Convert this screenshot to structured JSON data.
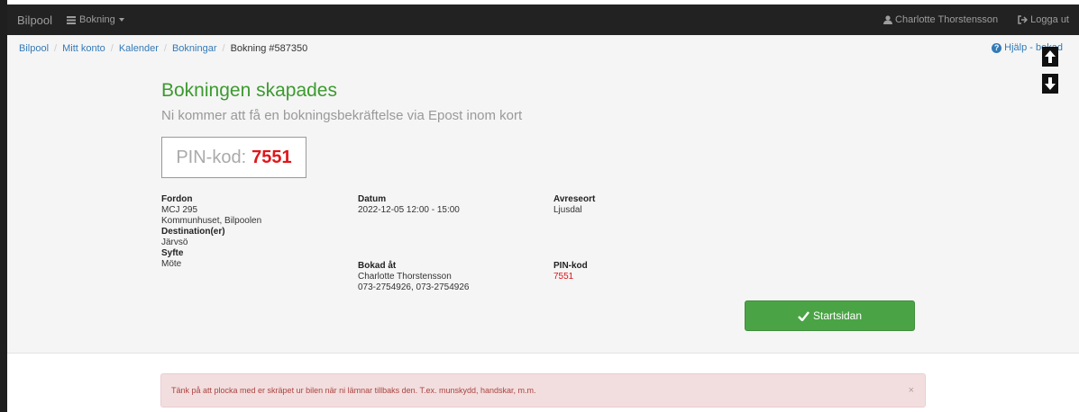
{
  "navbar": {
    "brand": "Bilpool",
    "menu_label": "Bokning",
    "user_name": "Charlotte Thorstensson",
    "logout_label": "Logga ut"
  },
  "breadcrumb": {
    "items": [
      "Bilpool",
      "Mitt konto",
      "Kalender",
      "Bokningar"
    ],
    "active": "Bokning #587350"
  },
  "help": {
    "label": "Hjälp - bokad"
  },
  "booking": {
    "title": "Bokningen skapades",
    "subtitle": "Ni kommer att få en bokningsbekräftelse via Epost inom kort",
    "pin_label": "PIN-kod:",
    "pin_value": "7551"
  },
  "details": {
    "fordon_label": "Fordon",
    "fordon_reg": "MCJ 295",
    "fordon_location": "Kommunhuset, Bilpoolen",
    "destination_label": "Destination(er)",
    "destination_value": "Järvsö",
    "syfte_label": "Syfte",
    "syfte_value": "Möte",
    "datum_label": "Datum",
    "datum_value": "2022-12-05 12:00 - 15:00",
    "bokad_label": "Bokad åt",
    "bokad_name": "Charlotte Thorstensson",
    "bokad_phone": "073-2754926, 073-2754926",
    "avreseort_label": "Avreseort",
    "avreseort_value": "Ljusdal",
    "pin_label": "PIN-kod",
    "pin_value": "7551"
  },
  "start_button": {
    "label": "Startsidan"
  },
  "alert": {
    "message": "Tänk på att plocka med er skräpet ur bilen när ni lämnar tillbaks den. T.ex. munskydd, handskar, m.m.",
    "close": "×"
  },
  "colors": {
    "success": "#3c9a2f",
    "pin": "#e0161b",
    "button": "#4aa445",
    "link": "#337ab7",
    "alert_bg": "#f2dede"
  }
}
